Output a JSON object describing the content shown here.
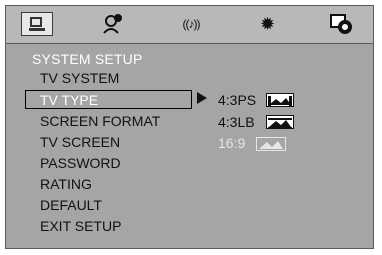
{
  "tabs": [
    {
      "icon": "monitor-icon",
      "label": ""
    },
    {
      "icon": "user-icon",
      "label": ""
    },
    {
      "icon": "speaker-icon",
      "label": "((♪))"
    },
    {
      "icon": "gear-icon",
      "label": "✹"
    },
    {
      "icon": "disc-icon",
      "label": ""
    }
  ],
  "screen": {
    "title": "SYSTEM SETUP",
    "menu": [
      {
        "label": "TV  SYSTEM",
        "selected": false
      },
      {
        "label": "TV TYPE",
        "selected": true
      },
      {
        "label": "SCREEN FORMAT",
        "selected": false
      },
      {
        "label": "TV SCREEN",
        "selected": false
      },
      {
        "label": "PASSWORD",
        "selected": false
      },
      {
        "label": "RATING",
        "selected": false
      },
      {
        "label": "DEFAULT",
        "selected": false
      },
      {
        "label": "EXIT SETUP",
        "selected": false
      }
    ],
    "options": [
      {
        "label": "4:3PS",
        "enabled": true
      },
      {
        "label": "4:3LB",
        "enabled": true
      },
      {
        "label": "16:9",
        "enabled": false
      }
    ]
  },
  "colors": {
    "panel": "#a5a5a5",
    "topbar": "#b8b8b8",
    "selected_text": "#ffffff",
    "disabled_text": "#e6e6e6"
  }
}
